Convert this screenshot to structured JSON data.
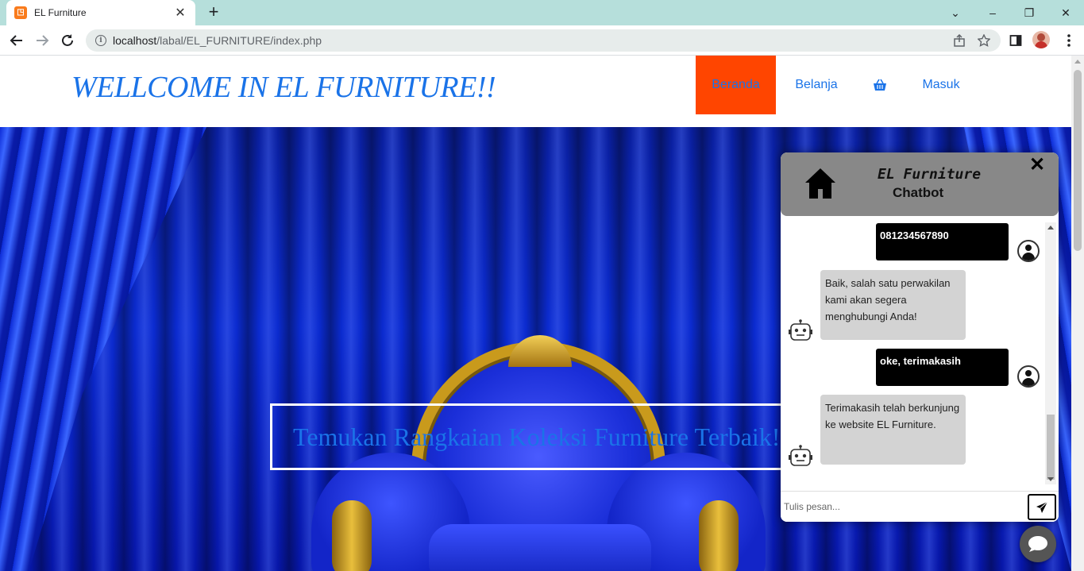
{
  "browser": {
    "tab_title": "EL Furniture",
    "url_host": "localhost",
    "url_path": "/labal/EL_FURNITURE/index.php"
  },
  "header": {
    "brand": "WELLCOME IN EL FURNITURE!!",
    "nav": {
      "home": "Beranda",
      "shop": "Belanja",
      "login": "Masuk"
    }
  },
  "hero": {
    "tagline": "Temukan Rangkaian Koleksi Furniture Terbaik!"
  },
  "chatbot": {
    "title_line1": "EL Furniture",
    "title_line2": "Chatbot",
    "messages": [
      {
        "from": "user",
        "text": "081234567890"
      },
      {
        "from": "bot",
        "text": "Baik, salah satu perwakilan kami akan segera menghubungi Anda!"
      },
      {
        "from": "user",
        "text": "oke, terimakasih"
      },
      {
        "from": "bot",
        "text": "Terimakasih telah berkunjung ke website EL Furniture."
      }
    ],
    "input_placeholder": "Tulis pesan..."
  },
  "colors": {
    "brand_blue": "#1a73e8",
    "active_nav": "#ff4500",
    "chat_header": "#888888",
    "user_bubble": "#000000",
    "bot_bubble": "#d3d3d3"
  },
  "icons": {
    "cart": "shopping-basket-icon",
    "chat_home": "home-icon",
    "send": "paper-plane-icon",
    "fab": "chat-bubble-icon"
  }
}
